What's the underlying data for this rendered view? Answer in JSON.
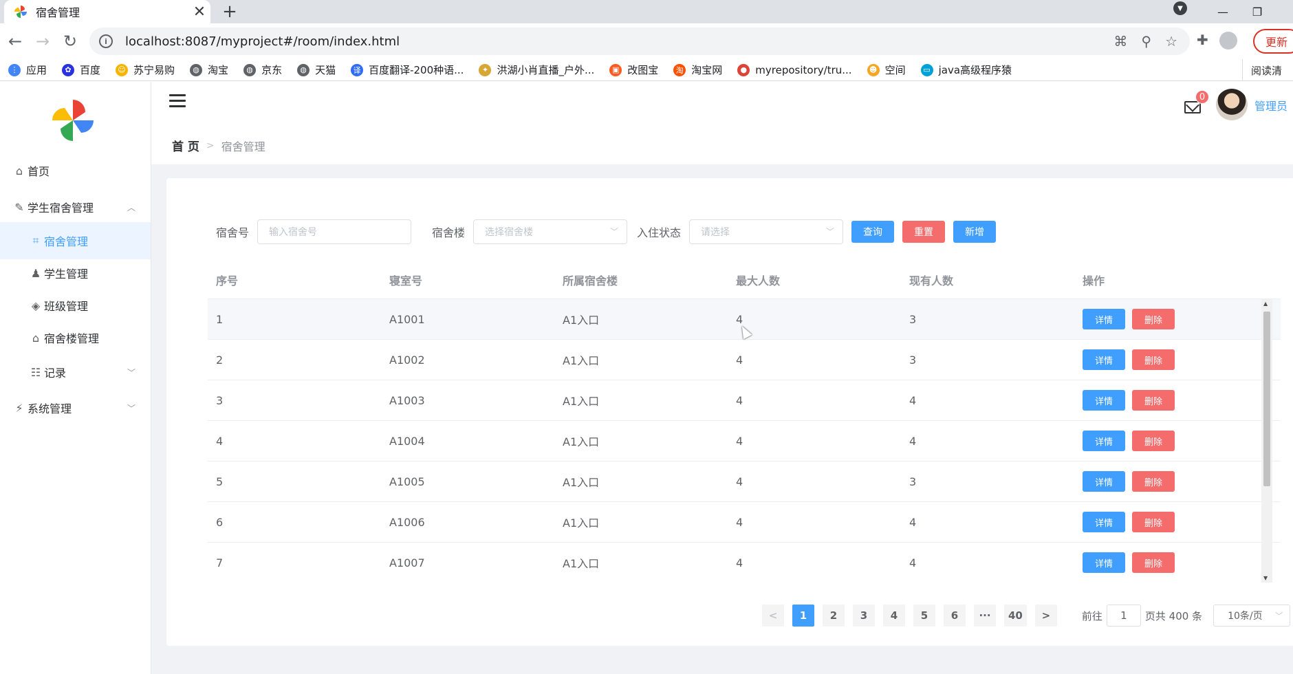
{
  "browser": {
    "tab_title": "宿舍管理",
    "tab_close": "✕",
    "new_tab": "+",
    "url": "localhost:8087/myproject#/room/index.html",
    "update_label": "更新",
    "profile_badge": "▼",
    "bookmarks": [
      {
        "label": "应用",
        "color": "#4285f4",
        "glyph": "⋮"
      },
      {
        "label": "百度",
        "color": "#2932e1",
        "glyph": "✿"
      },
      {
        "label": "苏宁易购",
        "color": "#f7b500",
        "glyph": "☺"
      },
      {
        "label": "淘宝",
        "color": "#5f6368",
        "glyph": "◍"
      },
      {
        "label": "京东",
        "color": "#5f6368",
        "glyph": "◍"
      },
      {
        "label": "天猫",
        "color": "#5f6368",
        "glyph": "◍"
      },
      {
        "label": "百度翻译-200种语...",
        "color": "#2f6df6",
        "glyph": "译"
      },
      {
        "label": "洪湖小肖直播_户外...",
        "color": "#d7a733",
        "glyph": "✦"
      },
      {
        "label": "改图宝",
        "color": "#ff5a1f",
        "glyph": "▣"
      },
      {
        "label": "淘宝网",
        "color": "#ff5000",
        "glyph": "淘"
      },
      {
        "label": "myrepository/tru...",
        "color": "#db4437",
        "glyph": "●"
      },
      {
        "label": "空间",
        "color": "#f5a623",
        "glyph": "☻"
      },
      {
        "label": "java高级程序猿",
        "color": "#00a1d6",
        "glyph": "▭"
      }
    ],
    "reading_list": "阅读清"
  },
  "sidebar": {
    "items": [
      {
        "label": "首页",
        "icon": "⌂",
        "arrow": ""
      },
      {
        "label": "学生宿舍管理",
        "icon": "✎",
        "arrow": "︿"
      },
      {
        "label": "宿舍管理",
        "icon": "⌗",
        "arrow": ""
      },
      {
        "label": "学生管理",
        "icon": "♟",
        "arrow": ""
      },
      {
        "label": "班级管理",
        "icon": "◈",
        "arrow": ""
      },
      {
        "label": "宿舍楼管理",
        "icon": "⌂",
        "arrow": ""
      },
      {
        "label": "记录",
        "icon": "☷",
        "arrow": "﹀"
      },
      {
        "label": "系统管理",
        "icon": "⚡",
        "arrow": "﹀"
      }
    ]
  },
  "header": {
    "breadcrumb_home": "首 页",
    "breadcrumb_sep": ">",
    "breadcrumb_current": "宿舍管理",
    "mail_badge": "0",
    "user_name": "管理员"
  },
  "filters": {
    "room_label": "宿舍号",
    "room_placeholder": "输入宿舍号",
    "building_label": "宿舍楼",
    "building_placeholder": "选择宿舍楼",
    "status_label": "入住状态",
    "status_placeholder": "请选择",
    "search_label": "查询",
    "reset_label": "重置",
    "add_label": "新增",
    "caret": "﹀"
  },
  "table": {
    "headers": [
      "序号",
      "寝室号",
      "所属宿舍楼",
      "最大人数",
      "现有人数",
      "操作"
    ],
    "detail_label": "详情",
    "delete_label": "删除",
    "rows": [
      [
        "1",
        "A1001",
        "A1入口",
        "4",
        "3"
      ],
      [
        "2",
        "A1002",
        "A1入口",
        "4",
        "3"
      ],
      [
        "3",
        "A1003",
        "A1入口",
        "4",
        "4"
      ],
      [
        "4",
        "A1004",
        "A1入口",
        "4",
        "4"
      ],
      [
        "5",
        "A1005",
        "A1入口",
        "4",
        "3"
      ],
      [
        "6",
        "A1006",
        "A1入口",
        "4",
        "4"
      ],
      [
        "7",
        "A1007",
        "A1入口",
        "4",
        "4"
      ]
    ]
  },
  "pagination": {
    "prev": "<",
    "next": ">",
    "pages": [
      "1",
      "2",
      "3",
      "4",
      "5",
      "6",
      "···",
      "40"
    ],
    "current": "1",
    "goto_label": "前往",
    "goto_value": "1",
    "total_label": "页共 400 条",
    "page_size": "10条/页",
    "caret": "﹀"
  },
  "colors": {
    "primary": "#409eff",
    "danger": "#f56c6c",
    "active_menu_bg": "#ecf5ff"
  }
}
